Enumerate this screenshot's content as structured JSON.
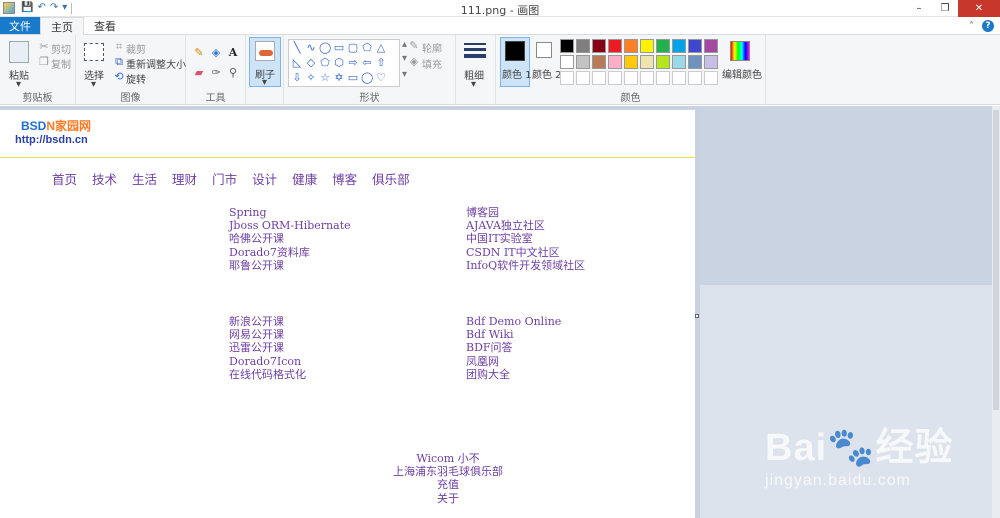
{
  "window": {
    "title": "111.png - 画图",
    "minimize": "–",
    "restore": "❐",
    "close": "✕"
  },
  "tabs": [
    {
      "label": "文件"
    },
    {
      "label": "主页"
    },
    {
      "label": "查看"
    }
  ],
  "ribbon": {
    "clipboard": {
      "label": "剪贴板",
      "paste": "粘贴",
      "cut": "剪切",
      "copy": "复制"
    },
    "image": {
      "label": "图像",
      "select": "选择",
      "crop": "裁剪",
      "resize": "重新调整大小",
      "rotate": "旋转"
    },
    "tools": {
      "label": "工具"
    },
    "brush": {
      "label": "刷子"
    },
    "shapes": {
      "label": "形状",
      "outline": "轮廓",
      "fill": "填充"
    },
    "size": {
      "label": "粗细"
    },
    "colors": {
      "label": "颜色",
      "color1": "颜色 1",
      "color2": "颜色 2",
      "edit": "编辑颜色",
      "row1": [
        "#000000",
        "#7f7f7f",
        "#880015",
        "#ed1c24",
        "#ff7f27",
        "#fff200",
        "#22b14c",
        "#00a2e8",
        "#3f48cc",
        "#a349a4"
      ],
      "row2": [
        "#ffffff",
        "#c3c3c3",
        "#b97a57",
        "#ffaec9",
        "#ffc90e",
        "#efe4b0",
        "#b5e61d",
        "#99d9ea",
        "#7092be",
        "#c8bfe7"
      ]
    }
  },
  "page": {
    "logo_b": "BSD",
    "logo_n": "N",
    "logo_rest": "家园网",
    "url": "http://bsdn.cn",
    "nav": [
      "首页",
      "技术",
      "生活",
      "理财",
      "门市",
      "设计",
      "健康",
      "博客",
      "俱乐部"
    ],
    "left_top": [
      "Spring",
      "Jboss ORM-Hibernate",
      "哈佛公开课",
      "Dorado7资料库",
      "耶鲁公开课"
    ],
    "right_top": [
      "博客园",
      "AJAVA独立社区",
      "中国IT实验室",
      "CSDN IT中文社区",
      "InfoQ软件开发领域社区"
    ],
    "left_bottom": [
      "新浪公开课",
      "网易公开课",
      "迅雷公开课",
      "Dorado7Icon",
      "在线代码格式化"
    ],
    "right_bottom": [
      "Bdf Demo Online",
      "Bdf Wiki",
      "BDF问答",
      "凤凰网",
      "团购大全"
    ],
    "footer": [
      "Wicom 小不",
      "上海浦东羽毛球俱乐部",
      "充值",
      "关于"
    ]
  },
  "watermark": {
    "big": "Bai🐾经验",
    "small": "jingyan.baidu.com"
  }
}
